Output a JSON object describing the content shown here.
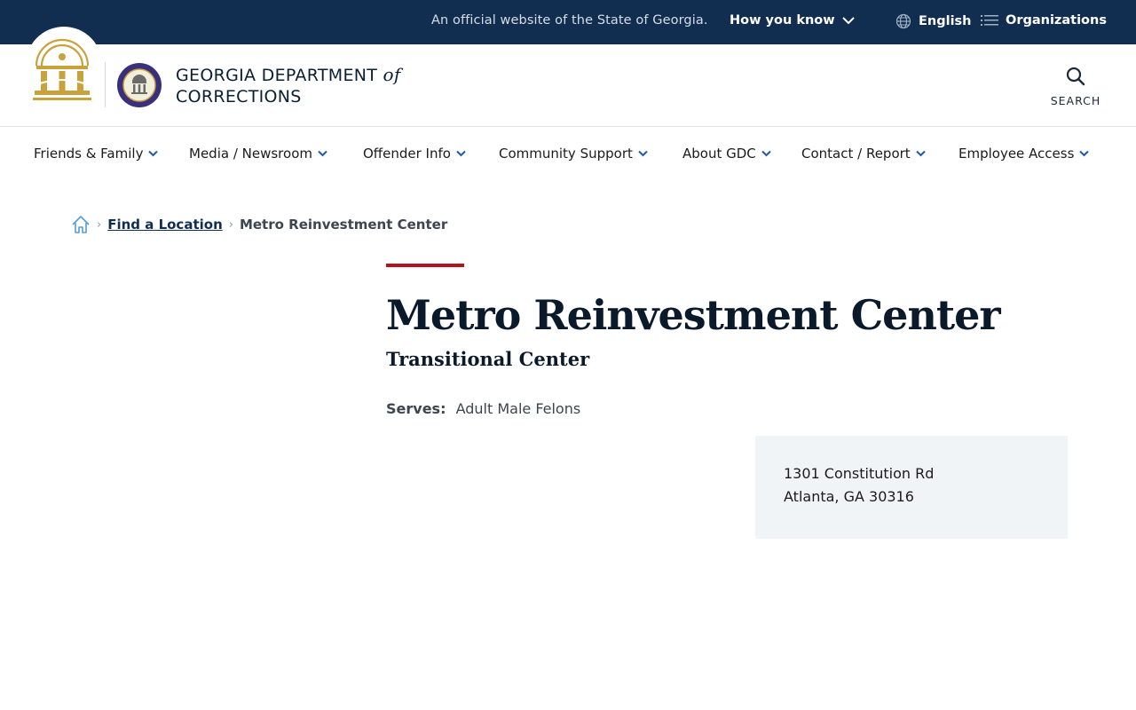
{
  "topbar": {
    "official_text": "An official website of the State of Georgia.",
    "how_you_know": "How you know",
    "language": "English",
    "organizations": "Organizations"
  },
  "header": {
    "agency_line1": "GEORGIA DEPARTMENT",
    "agency_of": "of",
    "agency_line2": "CORRECTIONS",
    "search_label": "SEARCH"
  },
  "nav": {
    "items": [
      {
        "label": "Friends & Family"
      },
      {
        "label": "Media / Newsroom"
      },
      {
        "label": "Offender Info"
      },
      {
        "label": "Community Support"
      },
      {
        "label": "About GDC"
      },
      {
        "label": "Contact / Report"
      },
      {
        "label": "Employee Access"
      }
    ]
  },
  "breadcrumb": {
    "items": [
      {
        "label": "Find a Location"
      },
      {
        "label": "Metro Reinvestment Center"
      }
    ]
  },
  "main": {
    "title": "Metro Reinvestment Center",
    "subtitle": "Transitional Center",
    "serves_label": "Serves:",
    "serves_value": "Adult Male Felons",
    "address_line1": "1301 Constitution Rd",
    "address_line2": "Atlanta, GA 30316"
  },
  "colors": {
    "topbar_bg": "#112e51",
    "accent_red": "#b5121b",
    "gold": "#c9a23c",
    "address_bg": "#f1f4f7"
  },
  "icons": [
    "chevron-down-icon",
    "globe-icon",
    "list-icon",
    "search-icon",
    "home-icon",
    "chevron-right-icon"
  ]
}
